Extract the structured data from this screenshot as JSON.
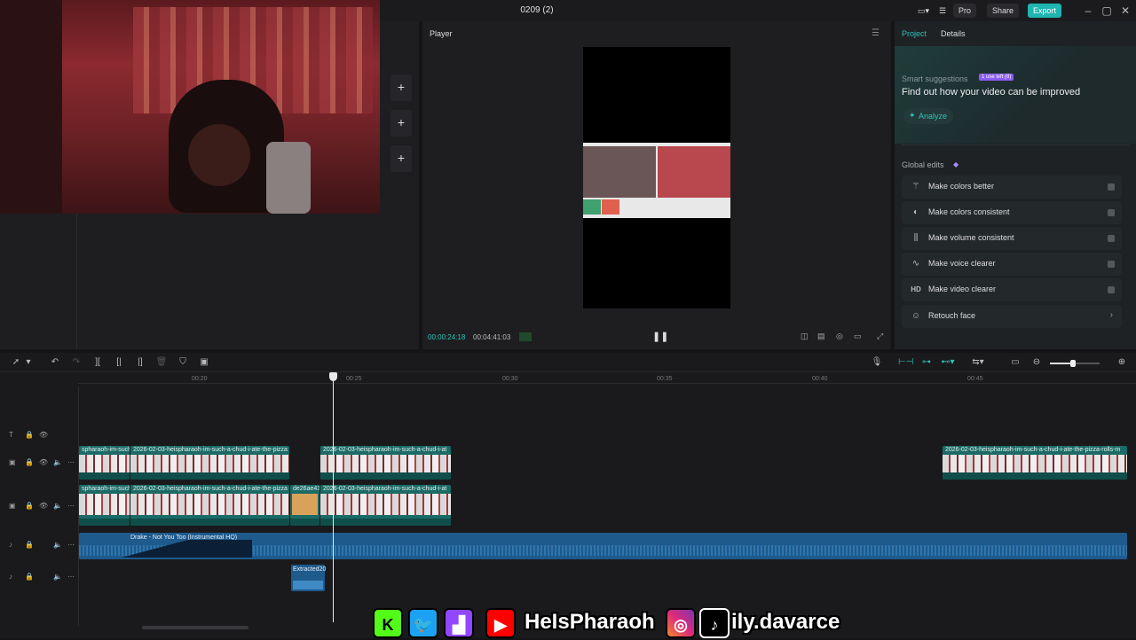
{
  "app": {
    "document_title": "0209 (2)",
    "pro_label": "Pro",
    "share_label": "Share",
    "export_label": "Export"
  },
  "player": {
    "title": "Player",
    "current_time": "00:00:24:18",
    "total_time": "00:04:41:03"
  },
  "right_panel": {
    "tabs": [
      "Project",
      "Details"
    ],
    "smart_suggestions_label": "Smart suggestions",
    "badge": "1 use left (8)",
    "headline": "Find out how your video can be improved",
    "analyze_label": "Analyze",
    "global_edits_label": "Global edits",
    "global_edits": [
      {
        "label": "Make colors better",
        "icon": "magic-wand-icon"
      },
      {
        "label": "Make colors consistent",
        "icon": "color-match-icon"
      },
      {
        "label": "Make volume consistent",
        "icon": "volume-bars-icon"
      },
      {
        "label": "Make voice clearer",
        "icon": "voice-wave-icon"
      },
      {
        "label": "Make video clearer",
        "icon": "hd-icon"
      },
      {
        "label": "Retouch face",
        "icon": "face-retouch-icon"
      }
    ]
  },
  "timeline": {
    "ruler": [
      "00:20",
      "00:25",
      "00:30",
      "00:35",
      "00:40",
      "00:45"
    ],
    "clips": {
      "v1_a": "spharaoh-im-such",
      "v1_b": "2026-02-03-heispharaoh-im-such-a-chud-i-ate-the-pizza",
      "v1_c": "2026-02-03-heispharaoh-im-such-a-chud-i-at",
      "v1_d": "2026-02-03-heispharaoh-im-such-a-chud-i-ate-the-pizza-rolls-m",
      "v2_a": "spharaoh-im-such",
      "v2_b": "2026-02-03-heispharaoh-im-such-a-chud-i-ate-the-pizza",
      "v2_c": "de26ae43",
      "v2_d": "2026-02-03-heispharaoh-im-such-a-chud-i-at",
      "audio": "Drake - Not You Too (Instrumental HQ)",
      "extracted": "Extracted20"
    }
  },
  "overlay": {
    "handle_name": "HeIsPharaoh",
    "tiktok_handle": "ily.davarce"
  }
}
